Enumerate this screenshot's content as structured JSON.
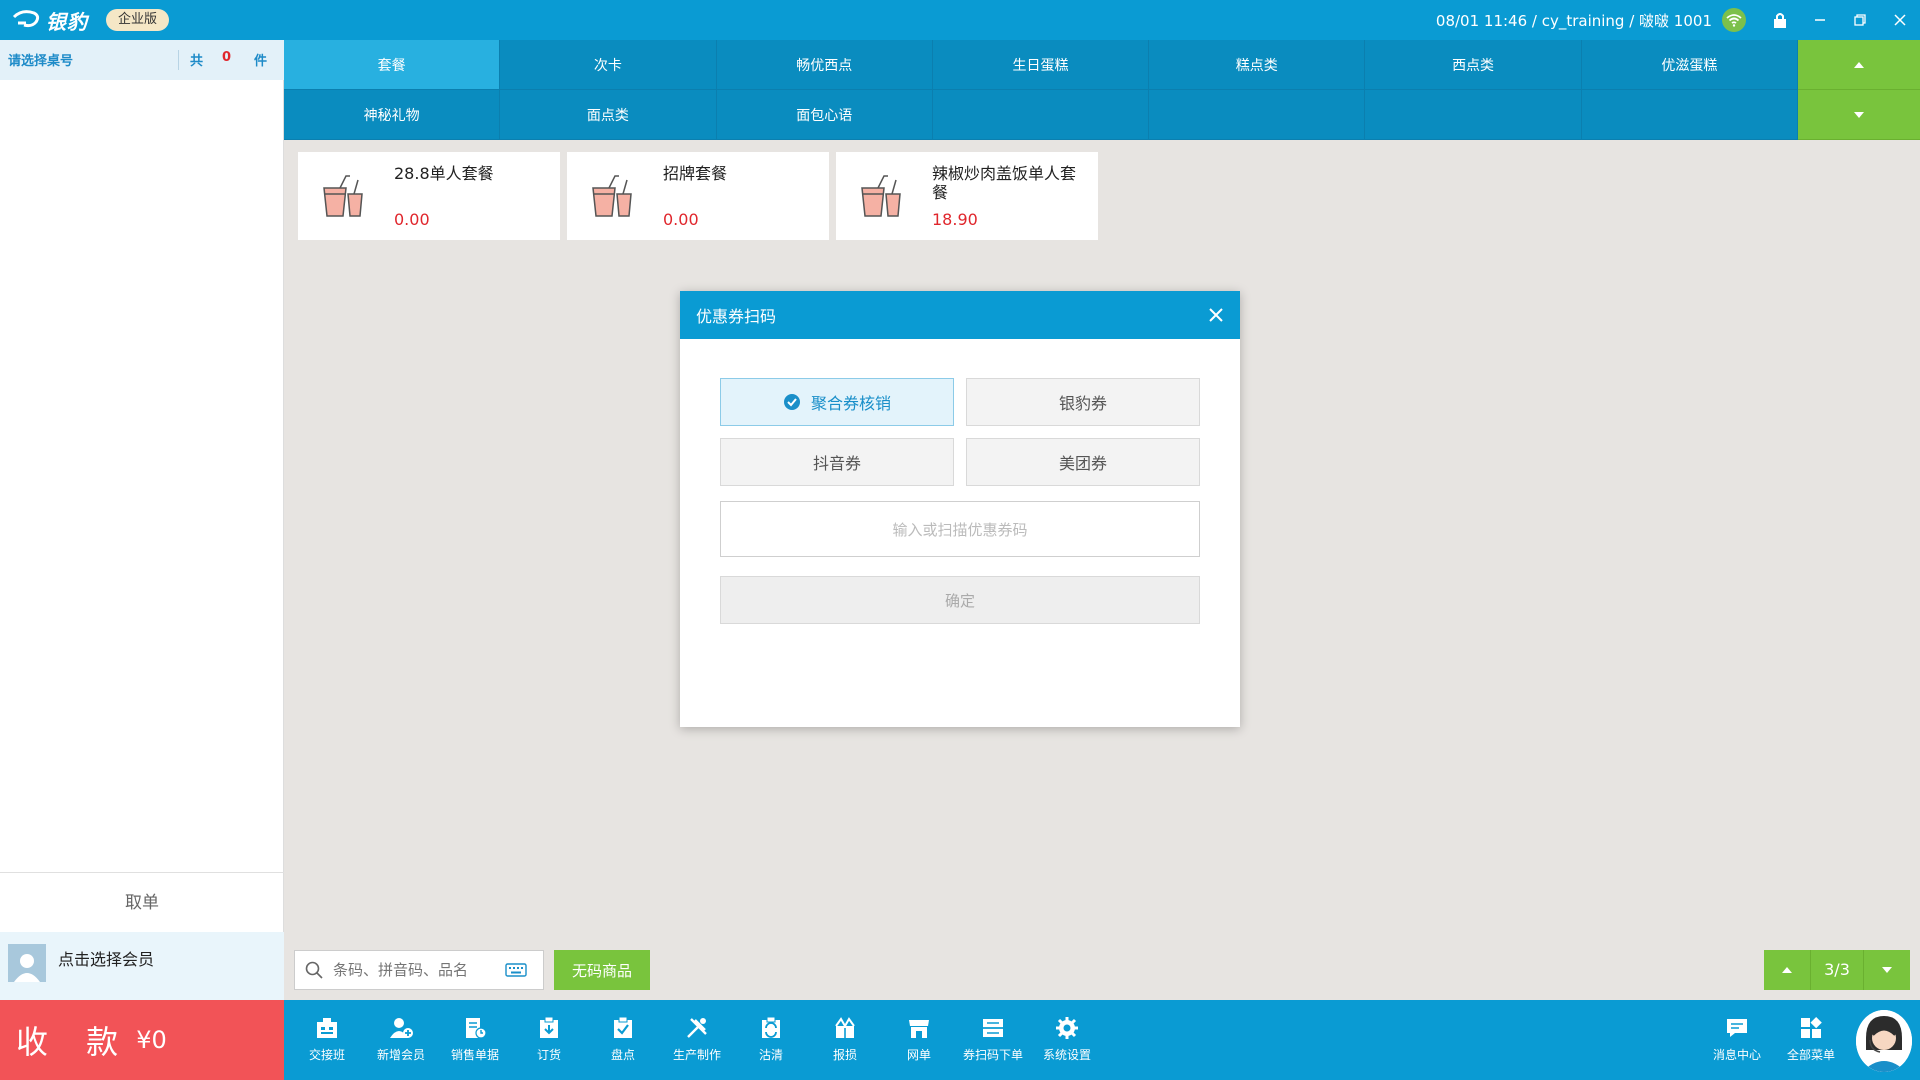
{
  "topbar": {
    "logo_text": "银豹",
    "edition": "企业版",
    "status": "08/01 11:46 / cy_training / 啵啵 1001"
  },
  "left": {
    "table_label": "请选择桌号",
    "total_prefix": "共",
    "count": "0",
    "unit": "件",
    "cancel_order": "取单",
    "member_prompt": "点击选择会员",
    "pay_label": "收 款",
    "pay_amount": "¥0"
  },
  "categories": [
    {
      "label": "套餐",
      "active": true
    },
    {
      "label": "次卡"
    },
    {
      "label": "畅优西点"
    },
    {
      "label": "生日蛋糕"
    },
    {
      "label": "糕点类"
    },
    {
      "label": "西点类"
    },
    {
      "label": "优滋蛋糕"
    },
    {
      "label": "神秘礼物"
    },
    {
      "label": "面点类"
    },
    {
      "label": "面包心语"
    }
  ],
  "products": [
    {
      "name": "28.8单人套餐",
      "price": "0.00"
    },
    {
      "name": "招牌套餐",
      "price": "0.00"
    },
    {
      "name": "辣椒炒肉盖饭单人套餐",
      "price": "18.90"
    }
  ],
  "search": {
    "placeholder": "条码、拼音码、品名",
    "nocode_button": "无码商品"
  },
  "pager": {
    "text": "3/3"
  },
  "toolbar": {
    "items": [
      {
        "label": "交接班",
        "icon": "handover-icon"
      },
      {
        "label": "新增会员",
        "icon": "add-member-icon"
      },
      {
        "label": "销售单据",
        "icon": "sales-doc-icon"
      },
      {
        "label": "订货",
        "icon": "order-goods-icon"
      },
      {
        "label": "盘点",
        "icon": "inventory-icon"
      },
      {
        "label": "生产制作",
        "icon": "production-icon"
      },
      {
        "label": "沽清",
        "icon": "sold-out-icon"
      },
      {
        "label": "报损",
        "icon": "loss-report-icon"
      },
      {
        "label": "网单",
        "icon": "online-order-icon"
      },
      {
        "label": "券扫码下单",
        "icon": "coupon-scan-icon"
      },
      {
        "label": "系统设置",
        "icon": "settings-icon"
      }
    ],
    "messages": "消息中心",
    "all_menu": "全部菜单"
  },
  "modal": {
    "title": "优惠券扫码",
    "options": [
      "聚合券核销",
      "银豹券",
      "抖音券",
      "美团券"
    ],
    "selected": "聚合券核销",
    "input_placeholder": "输入或扫描优惠券码",
    "confirm": "确定"
  },
  "colors": {
    "primary": "#0a9bd3",
    "accent_green": "#79c43d",
    "pay_red": "#f25357",
    "price_red": "#e0262c"
  }
}
